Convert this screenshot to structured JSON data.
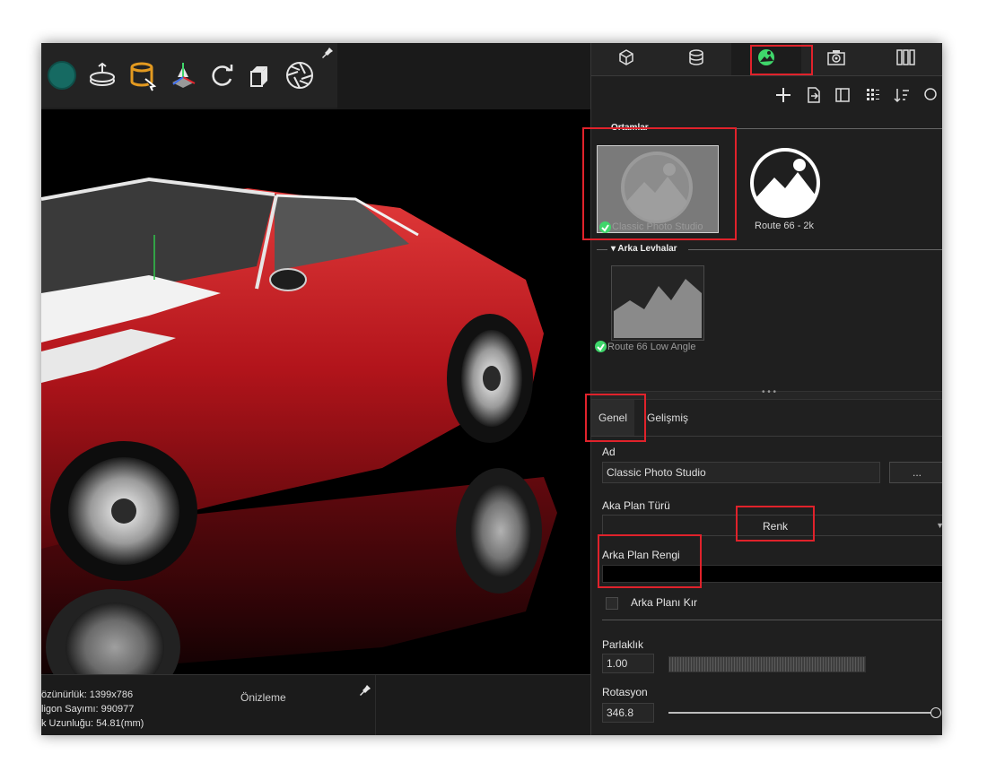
{
  "panel": {
    "tabs": [
      {
        "icon": "cube-icon"
      },
      {
        "icon": "database-icon"
      },
      {
        "icon": "environment-icon"
      },
      {
        "icon": "camera-icon"
      },
      {
        "icon": "columns-icon"
      }
    ],
    "actions": [
      "add-icon",
      "import-icon",
      "panel-icon",
      "grid-view-icon",
      "sort-icon",
      "search-icon"
    ],
    "environments_section": "Ortamlar",
    "environment_items": [
      {
        "label": "Classic Photo Studio",
        "selected": true
      },
      {
        "label": "Route 66 - 2k",
        "selected": false
      }
    ],
    "backplates_section": "▾ Arka Levhalar",
    "backplate_items": [
      {
        "label": "Route 66 Low Angle",
        "selected": true
      }
    ],
    "subtabs": [
      "Genel",
      "Gelişmiş"
    ],
    "fields": {
      "name_label": "Ad",
      "name_value": "Classic Photo Studio",
      "name_button": "...",
      "bg_type_label": "Aka Plan Türü",
      "bg_type_value": "Renk",
      "bg_color_label": "Arka Plan Rengi",
      "bg_color_value": "#000000",
      "blur_label": "Arka Planı Kır",
      "blur_checked": false,
      "brightness_label": "Parlaklık",
      "brightness_value": "1.00",
      "rotation_label": "Rotasyon",
      "rotation_value": "346.8"
    }
  },
  "toolbar": {
    "icons": [
      "color-sphere-icon",
      "turntable-icon",
      "material-bucket-icon",
      "gizmo-icon",
      "refresh-icon",
      "scene-cube-icon",
      "aperture-icon",
      "pin-icon"
    ]
  },
  "status": {
    "resolution": "özünürlük: 1399x786",
    "polygons": "ligon Sayımı: 990977",
    "focal": "k Uzunluğu: 54.81(mm)",
    "preview": "Önizleme"
  },
  "colors": {
    "highlight": "#e0222b",
    "accent_green": "#3fd66b",
    "car_red": "#c4161c"
  }
}
